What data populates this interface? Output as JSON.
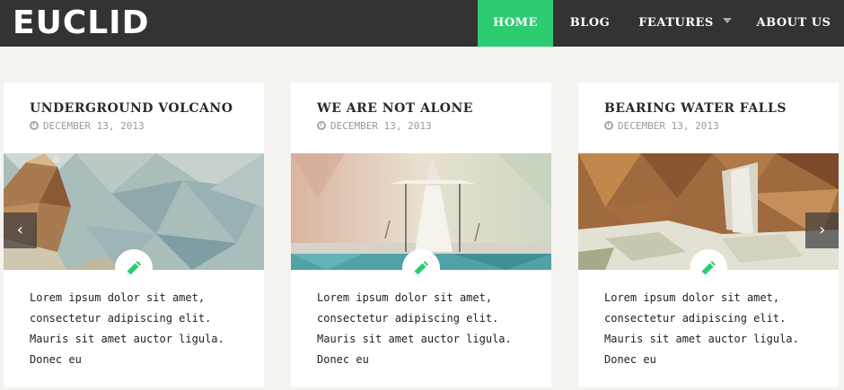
{
  "brand": {
    "logo": "EUCLID"
  },
  "nav": {
    "home": "HOME",
    "blog": "BLOG",
    "features": "FEATURES",
    "about": "ABOUT US"
  },
  "colors": {
    "accent": "#2ecc71",
    "topbar": "#333333",
    "background": "#f4f3f0"
  },
  "posts": [
    {
      "title": "UNDERGROUND VOLCANO",
      "date": "DECEMBER 13, 2013",
      "excerpt": "Lorem ipsum dolor sit amet, consectetur adipiscing elit. Mauris sit amet auctor ligula. Donec eu"
    },
    {
      "title": "WE ARE NOT ALONE",
      "date": "DECEMBER 13, 2013",
      "excerpt": "Lorem ipsum dolor sit amet, consectetur adipiscing elit. Mauris sit amet auctor ligula. Donec eu"
    },
    {
      "title": "BEARING WATER FALLS",
      "date": "DECEMBER 13, 2013",
      "excerpt": "Lorem ipsum dolor sit amet, consectetur adipiscing elit. Mauris sit amet auctor ligula. Donec eu"
    }
  ],
  "slider": {
    "prev_icon": "‹",
    "next_icon": "›"
  },
  "icons": {
    "date": "clock-icon",
    "post": "pencil-icon",
    "prev": "chevron-left-icon",
    "next": "chevron-right-icon"
  }
}
